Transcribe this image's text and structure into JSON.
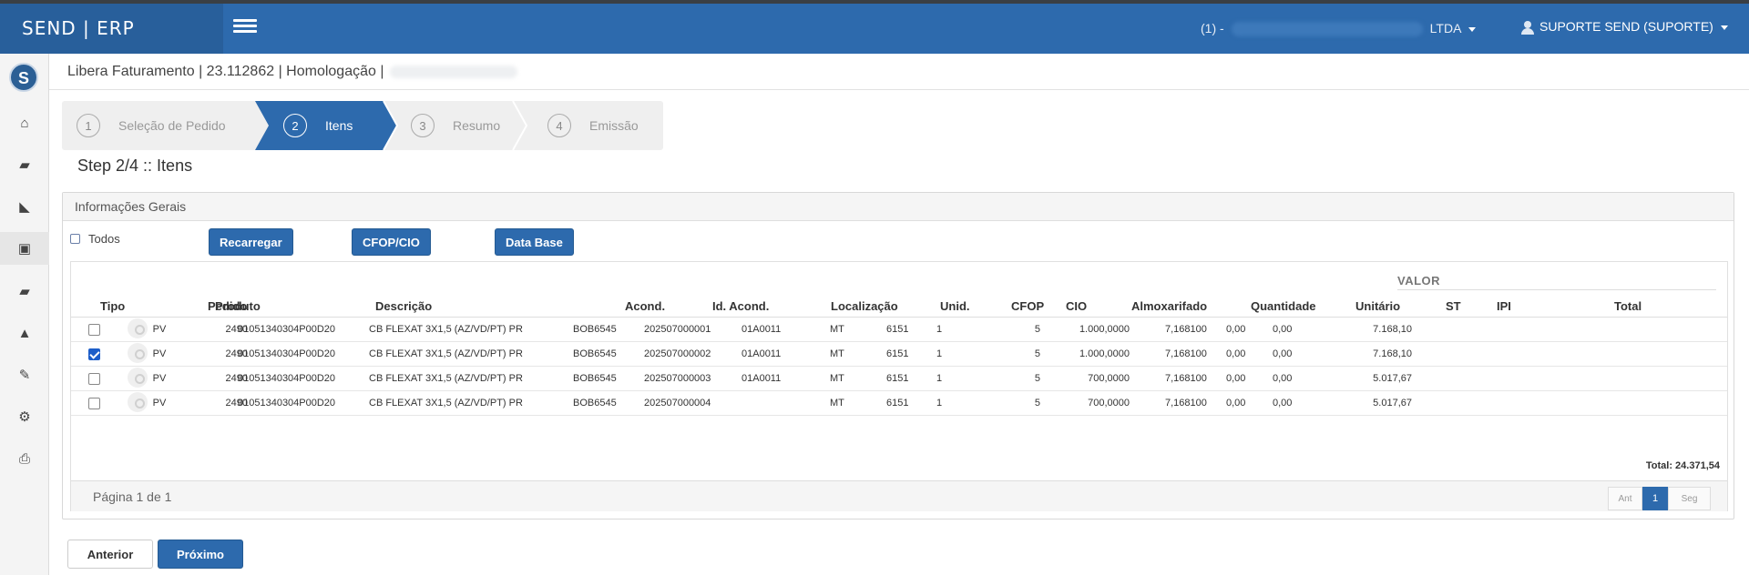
{
  "app": {
    "title": "SEND | ERP"
  },
  "colors": {
    "primary": "#2d6aad",
    "brand_dark": "#285f9b"
  },
  "header": {
    "company_prefix": "(1) -",
    "company_suffix": "LTDA",
    "user": "SUPORTE SEND (SUPORTE)",
    "menu_icon": "hamburger-icon",
    "user_icon": "user-icon"
  },
  "sidebar": {
    "logo_letter": "S",
    "items": [
      {
        "icon": "home-icon",
        "glyph": "⌂"
      },
      {
        "icon": "truck-icon",
        "glyph": "▰"
      },
      {
        "icon": "area-chart-icon",
        "glyph": "◣"
      },
      {
        "icon": "id-card-icon",
        "glyph": "▣"
      },
      {
        "icon": "truck-icon",
        "glyph": "▰"
      },
      {
        "icon": "road-icon",
        "glyph": "▲"
      },
      {
        "icon": "wrench-icon",
        "glyph": "✎"
      },
      {
        "icon": "cogs-icon",
        "glyph": "⚙"
      },
      {
        "icon": "print-icon",
        "glyph": "⎙"
      }
    ]
  },
  "breadcrumb": {
    "text": "Libera Faturamento | 23.112862 | Homologação |"
  },
  "wizard": {
    "steps": [
      {
        "num": "1",
        "label": "Seleção de Pedido"
      },
      {
        "num": "2",
        "label": "Itens"
      },
      {
        "num": "3",
        "label": "Resumo"
      },
      {
        "num": "4",
        "label": "Emissão"
      }
    ],
    "active_index": 1
  },
  "step_title": "Step 2/4 :: Itens",
  "panel": {
    "title": "Informações Gerais",
    "todos_label": "Todos",
    "buttons": {
      "reload": "Recarregar",
      "cfop": "CFOP/CIO",
      "date": "Data Base"
    }
  },
  "table": {
    "group_header": "VALOR",
    "columns": [
      "Tipo",
      "Pedido",
      "Produto",
      "Descrição",
      "Acond.",
      "Id. Acond.",
      "Localização",
      "Unid.",
      "CFOP",
      "CIO",
      "Almoxarifado",
      "Quantidade",
      "Unitário",
      "ST",
      "IPI",
      "Total"
    ],
    "rows": [
      {
        "checked": false,
        "tipo": "PV",
        "pedido": "2490",
        "produto": "01051340304P00D20",
        "descricao": "CB FLEXAT 3X1,5 (AZ/VD/PT) PR",
        "acond": "BOB6545",
        "id_acond": "202507000001",
        "localizacao": "01A0011",
        "unid": "MT",
        "cfop": "6151",
        "cio": "1",
        "almoxarifado": "5",
        "quantidade": "1.000,0000",
        "unitario": "7,168100",
        "st": "0,00",
        "ipi": "0,00",
        "total": "7.168,10"
      },
      {
        "checked": true,
        "tipo": "PV",
        "pedido": "2490",
        "produto": "01051340304P00D20",
        "descricao": "CB FLEXAT 3X1,5 (AZ/VD/PT) PR",
        "acond": "BOB6545",
        "id_acond": "202507000002",
        "localizacao": "01A0011",
        "unid": "MT",
        "cfop": "6151",
        "cio": "1",
        "almoxarifado": "5",
        "quantidade": "1.000,0000",
        "unitario": "7,168100",
        "st": "0,00",
        "ipi": "0,00",
        "total": "7.168,10"
      },
      {
        "checked": false,
        "tipo": "PV",
        "pedido": "2490",
        "produto": "01051340304P00D20",
        "descricao": "CB FLEXAT 3X1,5 (AZ/VD/PT) PR",
        "acond": "BOB6545",
        "id_acond": "202507000003",
        "localizacao": "01A0011",
        "unid": "MT",
        "cfop": "6151",
        "cio": "1",
        "almoxarifado": "5",
        "quantidade": "700,0000",
        "unitario": "7,168100",
        "st": "0,00",
        "ipi": "0,00",
        "total": "5.017,67"
      },
      {
        "checked": false,
        "tipo": "PV",
        "pedido": "2490",
        "produto": "01051340304P00D20",
        "descricao": "CB FLEXAT 3X1,5 (AZ/VD/PT) PR",
        "acond": "BOB6545",
        "id_acond": "202507000004",
        "localizacao": "",
        "unid": "MT",
        "cfop": "6151",
        "cio": "1",
        "almoxarifado": "5",
        "quantidade": "700,0000",
        "unitario": "7,168100",
        "st": "0,00",
        "ipi": "0,00",
        "total": "5.017,67"
      }
    ],
    "total_label": "Total: 24.371,54",
    "pagination": {
      "text": "Página 1 de 1",
      "prev": "Ant",
      "current": "1",
      "next": "Seg"
    }
  },
  "actions": {
    "prev": "Anterior",
    "next": "Próximo"
  }
}
